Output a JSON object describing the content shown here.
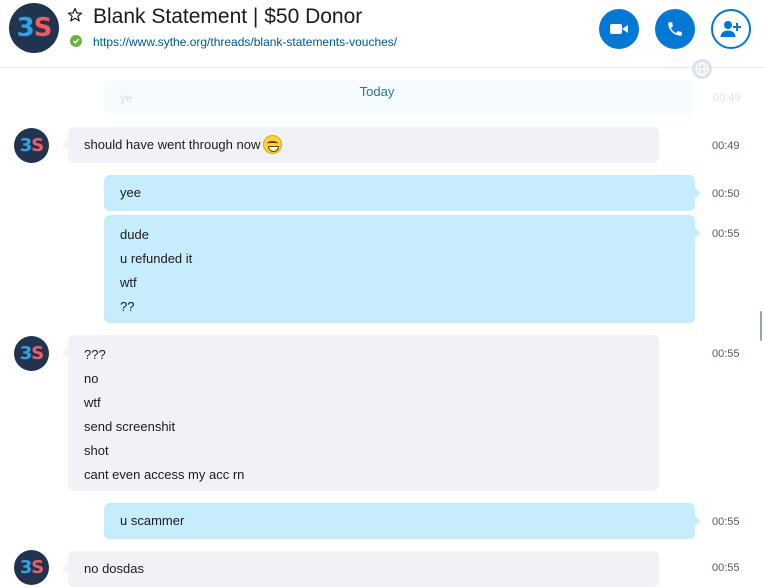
{
  "header": {
    "title": "Blank Statement | $50 Donor",
    "link": "https://www.sythe.org/threads/blank-statements-vouches/",
    "avatar_text_b": "3",
    "avatar_text_s": "S",
    "star_icon": "star-outline-icon",
    "status": "online",
    "colors": {
      "accent": "#0078d4",
      "status": "#6cb33e"
    }
  },
  "date_divider": "Today",
  "ghost_message": {
    "text": "ye",
    "time": "00:49"
  },
  "messages": [
    {
      "id": "m1",
      "dir": "in",
      "lines": [
        "should have went through now"
      ],
      "emoji": "grin-emoji",
      "time": "00:49"
    },
    {
      "id": "m2",
      "dir": "out",
      "lines": [
        "yee"
      ],
      "time": "00:50"
    },
    {
      "id": "m3",
      "dir": "out",
      "lines": [
        "dude",
        "u refunded it",
        "wtf",
        "??"
      ],
      "time": "00:55"
    },
    {
      "id": "m4",
      "dir": "in",
      "lines": [
        "???",
        "no",
        "wtf",
        "send screenshit",
        "shot",
        "cant even access my acc rn"
      ],
      "time": "00:55"
    },
    {
      "id": "m5",
      "dir": "out",
      "lines": [
        "u scammer"
      ],
      "time": "00:55"
    },
    {
      "id": "m6",
      "dir": "in",
      "lines": [
        "no dosdas"
      ],
      "time": "00:55"
    }
  ]
}
